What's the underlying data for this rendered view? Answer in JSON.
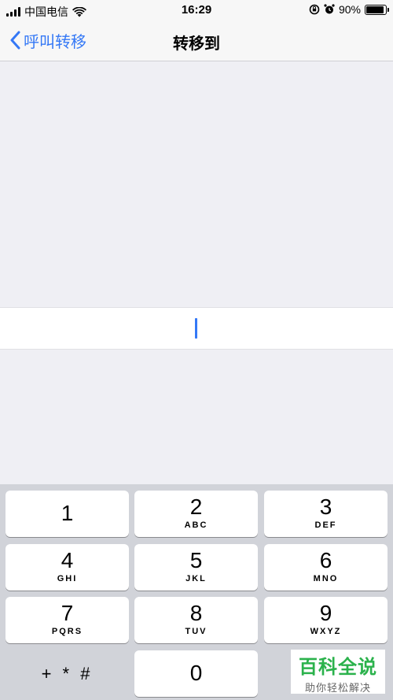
{
  "status_bar": {
    "carrier": "中国电信",
    "time": "16:29",
    "battery": "90%",
    "battery_level": 0.9
  },
  "nav": {
    "back_label": "呼叫转移",
    "title": "转移到"
  },
  "number_field": {
    "value": ""
  },
  "keypad": {
    "keys": [
      {
        "digit": "1",
        "letters": ""
      },
      {
        "digit": "2",
        "letters": "ABC"
      },
      {
        "digit": "3",
        "letters": "DEF"
      },
      {
        "digit": "4",
        "letters": "GHI"
      },
      {
        "digit": "5",
        "letters": "JKL"
      },
      {
        "digit": "6",
        "letters": "MNO"
      },
      {
        "digit": "7",
        "letters": "PQRS"
      },
      {
        "digit": "8",
        "letters": "TUV"
      },
      {
        "digit": "9",
        "letters": "WXYZ"
      },
      {
        "digit": "0",
        "letters": ""
      }
    ],
    "symbols": "+ * #"
  },
  "watermark": {
    "title": "百科全说",
    "subtitle": "助你轻松解决"
  },
  "colors": {
    "accent": "#3478f6",
    "background": "#efeff4",
    "keypad_background": "#d1d3d9",
    "watermark_green": "#2bb24c"
  }
}
